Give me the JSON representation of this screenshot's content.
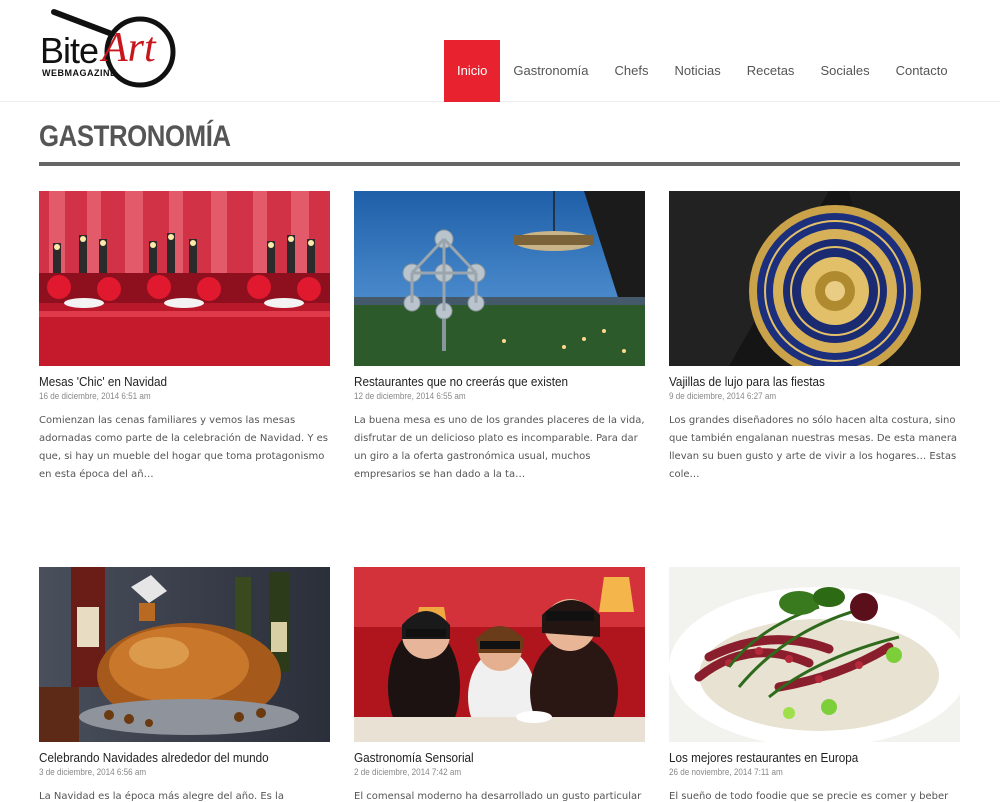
{
  "brand": {
    "name_part1": "Bite",
    "name_part2": "Art",
    "tagline": "WEBMAGAZINE"
  },
  "nav": [
    {
      "label": "Inicio",
      "active": true
    },
    {
      "label": "Gastronomía",
      "active": false
    },
    {
      "label": "Chefs",
      "active": false
    },
    {
      "label": "Noticias",
      "active": false
    },
    {
      "label": "Recetas",
      "active": false
    },
    {
      "label": "Sociales",
      "active": false
    },
    {
      "label": "Contacto",
      "active": false
    }
  ],
  "page": {
    "title": "GASTRONOMÍA"
  },
  "posts": [
    {
      "title": "Mesas 'Chic' en Navidad",
      "date": "16 de diciembre, 2014 6:51 am",
      "excerpt": "Comienzan las cenas familiares y vemos las mesas adornadas como parte de la celebración de Navidad. Y es que, si hay un mueble del hogar que toma protagonismo en esta época del añ…"
    },
    {
      "title": "Restaurantes que no creerás que existen",
      "date": "12 de diciembre, 2014 6:55 am",
      "excerpt": "La buena mesa es uno de los grandes placeres de la vida, disfrutar de un delicioso plato es incomparable. Para dar un giro a la oferta gastronómica usual, muchos empresarios se han dado a la ta…"
    },
    {
      "title": "Vajillas de lujo para las fiestas",
      "date": "9 de diciembre, 2014 6:27 am",
      "excerpt": "Los grandes diseñadores no sólo hacen alta costura, sino que también engalanan nuestras mesas. De esta manera llevan su buen gusto y arte de vivir a los hogares… Estas cole…"
    },
    {
      "title": "Celebrando Navidades alrededor del mundo",
      "date": "3 de diciembre, 2014 6:56 am",
      "excerpt": "La Navidad es la época más alegre del año. Es la festividad"
    },
    {
      "title": "Gastronomía Sensorial",
      "date": "2 de diciembre, 2014 7:42 am",
      "excerpt": "El comensal moderno ha desarrollado un gusto particular"
    },
    {
      "title": "Los mejores restaurantes en Europa",
      "date": "26 de noviembre, 2014 7:11 am",
      "excerpt": "El sueño de todo foodie que se precie es comer y beber en"
    }
  ]
}
